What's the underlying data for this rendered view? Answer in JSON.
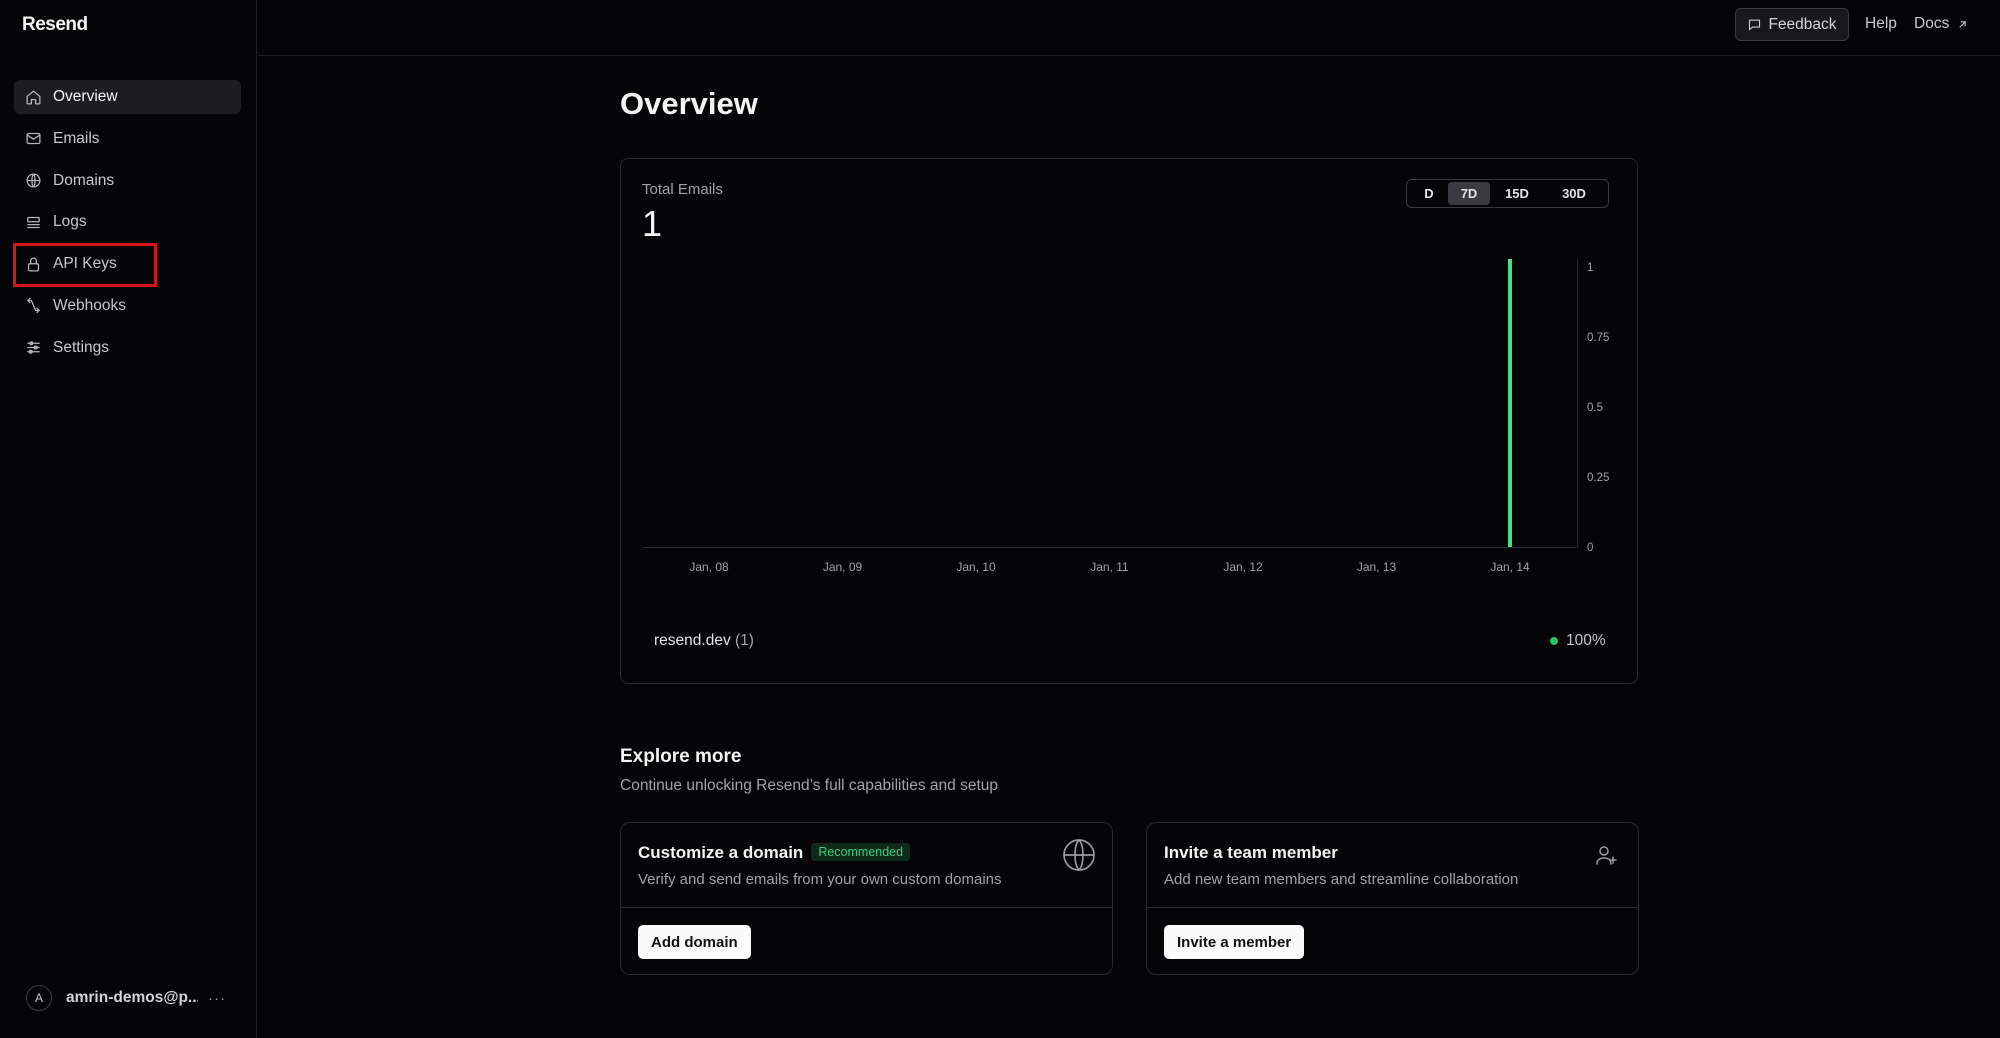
{
  "app": {
    "name": "Resend"
  },
  "sidebar": {
    "items": [
      {
        "label": "Overview",
        "icon": "home-icon",
        "active": true
      },
      {
        "label": "Emails",
        "icon": "mail-icon"
      },
      {
        "label": "Domains",
        "icon": "globe-icon"
      },
      {
        "label": "Logs",
        "icon": "logs-icon"
      },
      {
        "label": "API Keys",
        "icon": "lock-icon",
        "highlighted": true
      },
      {
        "label": "Webhooks",
        "icon": "webhook-icon"
      },
      {
        "label": "Settings",
        "icon": "sliders-icon"
      }
    ],
    "user": {
      "avatar_letter": "A",
      "name": "amrin-demos@p...",
      "more": "···"
    }
  },
  "topbar": {
    "feedback": "Feedback",
    "help": "Help",
    "docs": "Docs"
  },
  "page": {
    "title": "Overview"
  },
  "stats": {
    "label": "Total Emails",
    "value": "1",
    "ranges": [
      "D",
      "7D",
      "15D",
      "30D"
    ],
    "active_range": "7D",
    "legend": {
      "domain": "resend.dev",
      "count": "(1)",
      "percent": "100%"
    }
  },
  "chart_data": {
    "type": "bar",
    "categories": [
      "Jan, 08",
      "Jan, 09",
      "Jan, 10",
      "Jan, 11",
      "Jan, 12",
      "Jan, 13",
      "Jan, 14"
    ],
    "values": [
      0,
      0,
      0,
      0,
      0,
      0,
      1
    ],
    "yticks": [
      "0",
      "0.25",
      "0.5",
      "0.75",
      "1"
    ],
    "ylim": [
      0,
      1
    ],
    "color": "#4ade80",
    "grid": false
  },
  "explore": {
    "title": "Explore more",
    "subtitle": "Continue unlocking Resend’s full capabilities and setup",
    "cards": [
      {
        "title": "Customize a domain",
        "badge": "Recommended",
        "description": "Verify and send emails from your own custom domains",
        "button": "Add domain",
        "icon": "globe-icon"
      },
      {
        "title": "Invite a team member",
        "description": "Add new team members and streamline collaboration",
        "button": "Invite a member",
        "icon": "user-plus-icon"
      }
    ]
  },
  "colors": {
    "background": "#050507",
    "accent": "#4ade80",
    "highlight": "#d41616"
  }
}
